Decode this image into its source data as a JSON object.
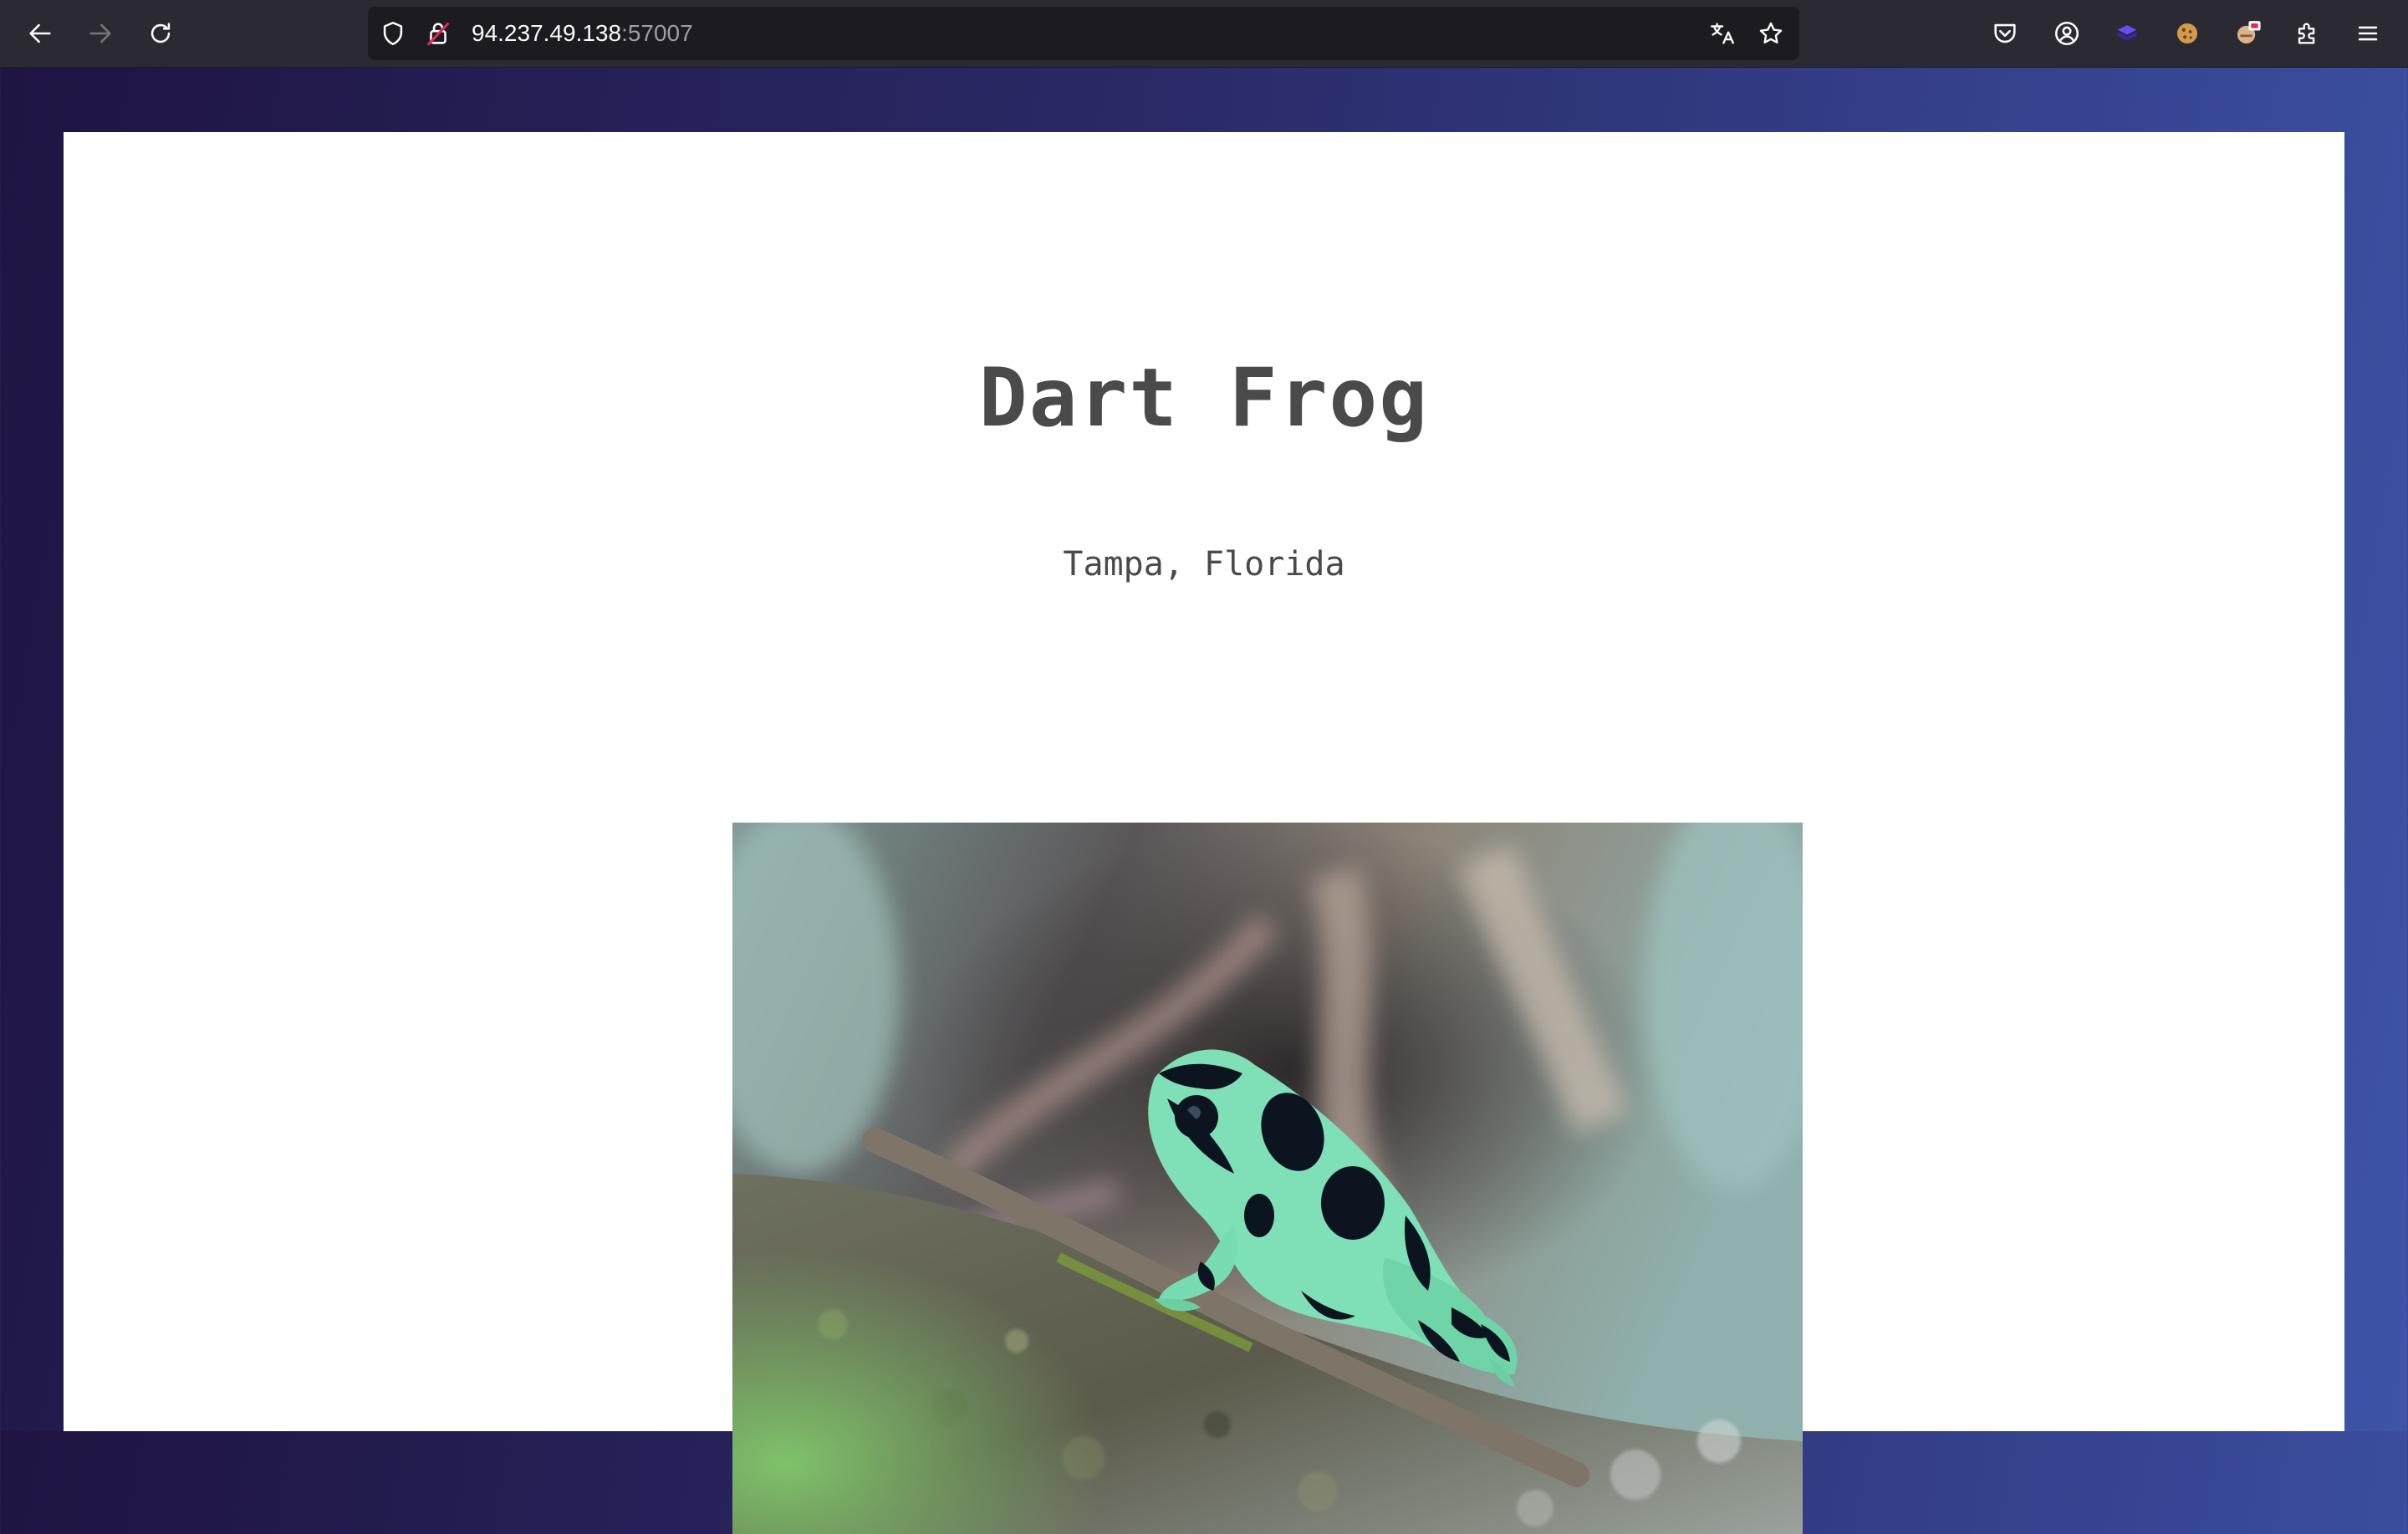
{
  "browser": {
    "url_host": "94.237.49.138",
    "url_port": ":57007",
    "icons": {
      "back": "back-arrow-icon",
      "forward": "forward-arrow-icon",
      "reload": "reload-icon",
      "tracking": "shield-icon",
      "security": "insecure-lock-icon",
      "translate": "translate-icon",
      "bookmark": "star-icon",
      "pocket": "pocket-icon",
      "account": "account-icon",
      "extensions": [
        "extension-cube-icon",
        "cookie-icon",
        "extension-badge-icon",
        "puzzle-icon"
      ],
      "menu": "hamburger-menu-icon"
    }
  },
  "page": {
    "title": "Dart Frog",
    "location": "Tampa, Florida",
    "image": {
      "subject": "green-and-black poison dart frog on a mossy branch"
    }
  },
  "colors": {
    "chrome_bg": "#2b2a33",
    "urlbar_bg": "#1c1b22",
    "page_text": "#4a4a4a",
    "frog_green": "#7fe0b8",
    "frog_black": "#0c1420"
  }
}
